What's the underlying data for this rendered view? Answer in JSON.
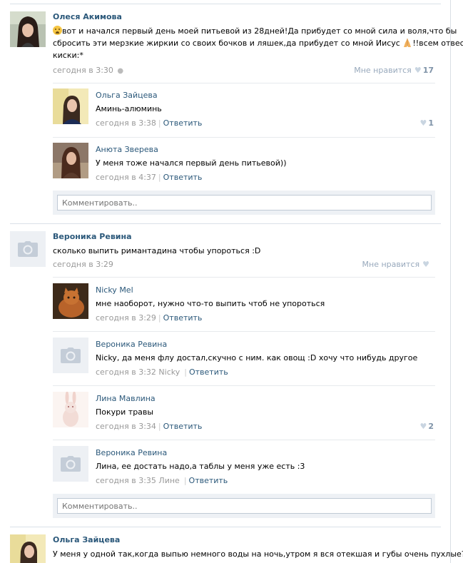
{
  "posts": [
    {
      "author": "Олеся Акимова",
      "text_line1": "вот и начался первый день моей питьевой из 28дней!Да прибудет со мной сила и воля,что бы",
      "text_line2": "сбросить эти мерзкие жиркии со своих бочков и ляшек,да прибудет со мной Иисус",
      "text_line2_end": "!!всем отвесов",
      "text_line3": "киски:*",
      "time": "сегодня в 3:30",
      "like_label": "Мне нравится",
      "like_count": "17",
      "replies": [
        {
          "author": "Ольга Зайцева",
          "text": "Аминь-алюминь",
          "time": "сегодня в 3:38",
          "reply_label": "Ответить",
          "like_count": "1"
        },
        {
          "author": "Анюта Зверева",
          "text": "У меня тоже начался первый день питьевой))",
          "time": "сегодня в 4:37",
          "reply_label": "Ответить"
        }
      ],
      "comment_placeholder": "Комментировать.."
    },
    {
      "author": "Вероника Ревина",
      "text": "сколько выпить римантадина чтобы упороться :D",
      "time": "сегодня в 3:29",
      "like_label": "Мне нравится",
      "replies": [
        {
          "author": "Nicky Mel",
          "text": "мне наоборот, нужно что-то выпить чтоб не упороться",
          "time": "сегодня в 3:29",
          "reply_label": "Ответить"
        },
        {
          "author": "Вероника Ревина",
          "text": "Nicky, да меня флу достал,скучно с ним. как овощ :D хочу что нибудь другое",
          "time": "сегодня в 3:32",
          "to": "Nicky",
          "reply_label": "Ответить"
        },
        {
          "author": "Лина Мавлина",
          "text": "Покури травы",
          "time": "сегодня в 3:34",
          "reply_label": "Ответить",
          "like_count": "2"
        },
        {
          "author": "Вероника Ревина",
          "text": "Лина, ее достать надо,а таблы у меня уже есть :3",
          "time": "сегодня в 3:35",
          "to": "Лине",
          "reply_label": "Ответить"
        }
      ],
      "comment_placeholder": "Комментировать.."
    },
    {
      "author": "Ольга Зайцева",
      "text": "У меня у одной так,когда выпью немного воды на ночь,утром я вся отекшая и губы очень пухлые?"
    }
  ]
}
